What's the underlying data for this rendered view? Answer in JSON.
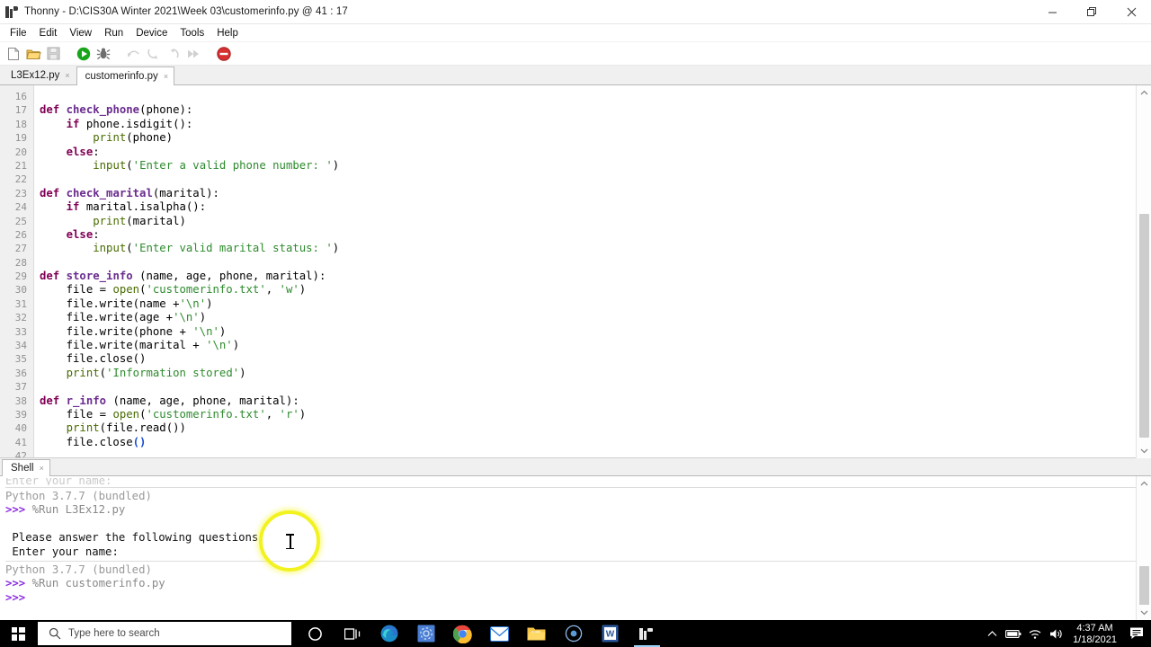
{
  "window": {
    "app_name": "Thonny",
    "title": "Thonny  -  D:\\CIS30A Winter 2021\\Week 03\\customerinfo.py  @  41 : 17",
    "cursor_position": "41 : 17",
    "file_path": "D:\\CIS30A Winter 2021\\Week 03\\customerinfo.py",
    "controls": {
      "minimize": "minimize",
      "restore": "restore",
      "close": "close"
    }
  },
  "menu": {
    "items": [
      {
        "label": "File"
      },
      {
        "label": "Edit"
      },
      {
        "label": "View"
      },
      {
        "label": "Run"
      },
      {
        "label": "Device"
      },
      {
        "label": "Tools"
      },
      {
        "label": "Help"
      }
    ]
  },
  "toolbar": {
    "buttons": [
      {
        "name": "new-file-icon",
        "title": "New",
        "enabled": true
      },
      {
        "name": "open-file-icon",
        "title": "Load",
        "enabled": true
      },
      {
        "name": "save-file-icon",
        "title": "Save",
        "enabled": true
      },
      {
        "name": "run-icon",
        "title": "Run current script",
        "enabled": true
      },
      {
        "name": "debug-icon",
        "title": "Debug current script",
        "enabled": true
      },
      {
        "name": "step-over-icon",
        "title": "Step over",
        "enabled": false
      },
      {
        "name": "step-into-icon",
        "title": "Step into",
        "enabled": false
      },
      {
        "name": "step-out-icon",
        "title": "Step out",
        "enabled": false
      },
      {
        "name": "resume-icon",
        "title": "Resume",
        "enabled": false
      },
      {
        "name": "stop-icon",
        "title": "Stop/Restart backend",
        "enabled": true
      }
    ]
  },
  "editor": {
    "tabs": [
      {
        "label": "L3Ex12.py",
        "active": false
      },
      {
        "label": "customerinfo.py",
        "active": true
      }
    ],
    "first_line_number": 16,
    "lines": [
      {
        "n": 16,
        "tokens": []
      },
      {
        "n": 17,
        "tokens": [
          {
            "t": "def ",
            "c": "k-def"
          },
          {
            "t": "check_phone",
            "c": "k-fn"
          },
          {
            "t": "(phone):",
            "c": "k-plain"
          }
        ]
      },
      {
        "n": 18,
        "tokens": [
          {
            "t": "    ",
            "c": "k-plain"
          },
          {
            "t": "if",
            "c": "k-kw"
          },
          {
            "t": " phone.isdigit():",
            "c": "k-plain"
          }
        ]
      },
      {
        "n": 19,
        "tokens": [
          {
            "t": "        ",
            "c": "k-plain"
          },
          {
            "t": "print",
            "c": "k-bi"
          },
          {
            "t": "(phone)",
            "c": "k-plain"
          }
        ]
      },
      {
        "n": 20,
        "tokens": [
          {
            "t": "    ",
            "c": "k-plain"
          },
          {
            "t": "else",
            "c": "k-kw"
          },
          {
            "t": ":",
            "c": "k-plain"
          }
        ]
      },
      {
        "n": 21,
        "tokens": [
          {
            "t": "        ",
            "c": "k-plain"
          },
          {
            "t": "input",
            "c": "k-bi"
          },
          {
            "t": "(",
            "c": "k-plain"
          },
          {
            "t": "'Enter a valid phone number: '",
            "c": "k-str"
          },
          {
            "t": ")",
            "c": "k-plain"
          }
        ]
      },
      {
        "n": 22,
        "tokens": []
      },
      {
        "n": 23,
        "tokens": [
          {
            "t": "def ",
            "c": "k-def"
          },
          {
            "t": "check_marital",
            "c": "k-fn"
          },
          {
            "t": "(marital):",
            "c": "k-plain"
          }
        ]
      },
      {
        "n": 24,
        "tokens": [
          {
            "t": "    ",
            "c": "k-plain"
          },
          {
            "t": "if",
            "c": "k-kw"
          },
          {
            "t": " marital.isalpha():",
            "c": "k-plain"
          }
        ]
      },
      {
        "n": 25,
        "tokens": [
          {
            "t": "        ",
            "c": "k-plain"
          },
          {
            "t": "print",
            "c": "k-bi"
          },
          {
            "t": "(marital)",
            "c": "k-plain"
          }
        ]
      },
      {
        "n": 26,
        "tokens": [
          {
            "t": "    ",
            "c": "k-plain"
          },
          {
            "t": "else",
            "c": "k-kw"
          },
          {
            "t": ":",
            "c": "k-plain"
          }
        ]
      },
      {
        "n": 27,
        "tokens": [
          {
            "t": "        ",
            "c": "k-plain"
          },
          {
            "t": "input",
            "c": "k-bi"
          },
          {
            "t": "(",
            "c": "k-plain"
          },
          {
            "t": "'Enter valid marital status: '",
            "c": "k-str"
          },
          {
            "t": ")",
            "c": "k-plain"
          }
        ]
      },
      {
        "n": 28,
        "tokens": []
      },
      {
        "n": 29,
        "tokens": [
          {
            "t": "def ",
            "c": "k-def"
          },
          {
            "t": "store_info",
            "c": "k-fn"
          },
          {
            "t": " (name, age, phone, marital):",
            "c": "k-plain"
          }
        ]
      },
      {
        "n": 30,
        "tokens": [
          {
            "t": "    file = ",
            "c": "k-plain"
          },
          {
            "t": "open",
            "c": "k-bi"
          },
          {
            "t": "(",
            "c": "k-plain"
          },
          {
            "t": "'customerinfo.txt'",
            "c": "k-str"
          },
          {
            "t": ", ",
            "c": "k-plain"
          },
          {
            "t": "'w'",
            "c": "k-str"
          },
          {
            "t": ")",
            "c": "k-plain"
          }
        ]
      },
      {
        "n": 31,
        "tokens": [
          {
            "t": "    file.write(name +",
            "c": "k-plain"
          },
          {
            "t": "'\\n'",
            "c": "k-str"
          },
          {
            "t": ")",
            "c": "k-plain"
          }
        ]
      },
      {
        "n": 32,
        "tokens": [
          {
            "t": "    file.write(age +",
            "c": "k-plain"
          },
          {
            "t": "'\\n'",
            "c": "k-str"
          },
          {
            "t": ")",
            "c": "k-plain"
          }
        ]
      },
      {
        "n": 33,
        "tokens": [
          {
            "t": "    file.write(phone + ",
            "c": "k-plain"
          },
          {
            "t": "'\\n'",
            "c": "k-str"
          },
          {
            "t": ")",
            "c": "k-plain"
          }
        ]
      },
      {
        "n": 34,
        "tokens": [
          {
            "t": "    file.write(marital + ",
            "c": "k-plain"
          },
          {
            "t": "'\\n'",
            "c": "k-str"
          },
          {
            "t": ")",
            "c": "k-plain"
          }
        ]
      },
      {
        "n": 35,
        "tokens": [
          {
            "t": "    file.close()",
            "c": "k-plain"
          }
        ]
      },
      {
        "n": 36,
        "tokens": [
          {
            "t": "    ",
            "c": "k-plain"
          },
          {
            "t": "print",
            "c": "k-bi"
          },
          {
            "t": "(",
            "c": "k-plain"
          },
          {
            "t": "'Information stored'",
            "c": "k-str"
          },
          {
            "t": ")",
            "c": "k-plain"
          }
        ]
      },
      {
        "n": 37,
        "tokens": []
      },
      {
        "n": 38,
        "tokens": [
          {
            "t": "def ",
            "c": "k-def"
          },
          {
            "t": "r_info",
            "c": "k-fn"
          },
          {
            "t": " (name, age, phone, marital):",
            "c": "k-plain"
          }
        ]
      },
      {
        "n": 39,
        "tokens": [
          {
            "t": "    file = ",
            "c": "k-plain"
          },
          {
            "t": "open",
            "c": "k-bi"
          },
          {
            "t": "(",
            "c": "k-plain"
          },
          {
            "t": "'customerinfo.txt'",
            "c": "k-str"
          },
          {
            "t": ", ",
            "c": "k-plain"
          },
          {
            "t": "'r'",
            "c": "k-str"
          },
          {
            "t": ")",
            "c": "k-plain"
          }
        ]
      },
      {
        "n": 40,
        "tokens": [
          {
            "t": "    ",
            "c": "k-plain"
          },
          {
            "t": "print",
            "c": "k-bi"
          },
          {
            "t": "(file.read())",
            "c": "k-plain"
          }
        ]
      },
      {
        "n": 41,
        "tokens": [
          {
            "t": "    file.close",
            "c": "k-plain"
          },
          {
            "t": "()",
            "c": "k-brk"
          }
        ]
      },
      {
        "n": 42,
        "tokens": []
      }
    ]
  },
  "shell": {
    "tab_label": "Shell",
    "lines": [
      {
        "segs": [
          {
            "t": "Enter your name:",
            "c": "sh-clip"
          }
        ],
        "clipped": true
      },
      {
        "divider": true
      },
      {
        "segs": [
          {
            "t": "Python 3.7.7 (bundled)",
            "c": "sh-sys"
          }
        ]
      },
      {
        "segs": [
          {
            "t": ">>> ",
            "c": "sh-prompt"
          },
          {
            "t": "%Run L3Ex12.py",
            "c": "sh-cmd"
          }
        ]
      },
      {
        "segs": []
      },
      {
        "segs": [
          {
            "t": " Please answer the following questions",
            "c": "sh-out"
          }
        ]
      },
      {
        "segs": [
          {
            "t": " Enter your name:",
            "c": "sh-out"
          }
        ]
      },
      {
        "divider": true
      },
      {
        "segs": [
          {
            "t": "Python 3.7.7 (bundled)",
            "c": "sh-sys"
          }
        ]
      },
      {
        "segs": [
          {
            "t": ">>> ",
            "c": "sh-prompt"
          },
          {
            "t": "%Run customerinfo.py",
            "c": "sh-cmd"
          }
        ]
      },
      {
        "segs": [
          {
            "t": ">>>",
            "c": "sh-prompt"
          }
        ]
      }
    ]
  },
  "taskbar": {
    "search_placeholder": "Type here to search",
    "apps": [
      {
        "name": "taskbar-edge",
        "label": "Microsoft Edge",
        "active": false
      },
      {
        "name": "taskbar-settings",
        "label": "Settings",
        "active": false
      },
      {
        "name": "taskbar-chrome",
        "label": "Google Chrome",
        "active": false
      },
      {
        "name": "taskbar-mail",
        "label": "Mail",
        "active": false
      },
      {
        "name": "taskbar-explorer",
        "label": "File Explorer",
        "active": false
      },
      {
        "name": "taskbar-media",
        "label": "Media Player",
        "active": false
      },
      {
        "name": "taskbar-word",
        "label": "Microsoft Word",
        "active": false
      },
      {
        "name": "taskbar-thonny",
        "label": "Thonny",
        "active": true
      }
    ],
    "clock": {
      "time": "4:37 AM",
      "date": "1/18/2021"
    }
  },
  "colors": {
    "accent_run": "#1aa81a",
    "accent_stop": "#d9303a",
    "string": "#2e8b2e",
    "keyword": "#7f0055",
    "function": "#6a2c8f",
    "builtin": "#486b00",
    "bracket_match": "#1a4fd6",
    "prompt": "#8a2be2",
    "cursor_highlight": "#f2f21f"
  }
}
